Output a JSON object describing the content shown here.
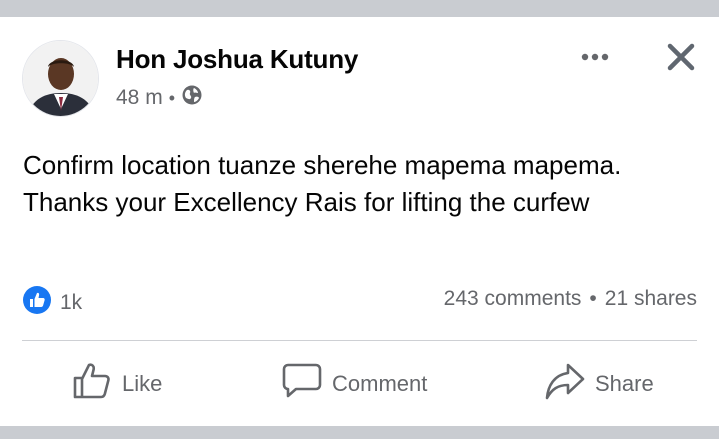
{
  "post": {
    "author": "Hon Joshua Kutuny",
    "time": "48 m",
    "separator": "•",
    "visibility_icon": "globe-icon",
    "text": "Confirm location tuanze sherehe mapema mapema. Thanks your Excellency Rais for lifting the curfew"
  },
  "reactions": {
    "icon": "like-reaction-icon",
    "count": "1k"
  },
  "stats": {
    "comments": "243 comments",
    "separator": "•",
    "shares": "21 shares"
  },
  "actions": {
    "like": "Like",
    "comment": "Comment",
    "share": "Share"
  },
  "colors": {
    "accent": "#1877f2",
    "muted": "#65676b",
    "text": "#050505",
    "band": "#c9ccd1"
  }
}
